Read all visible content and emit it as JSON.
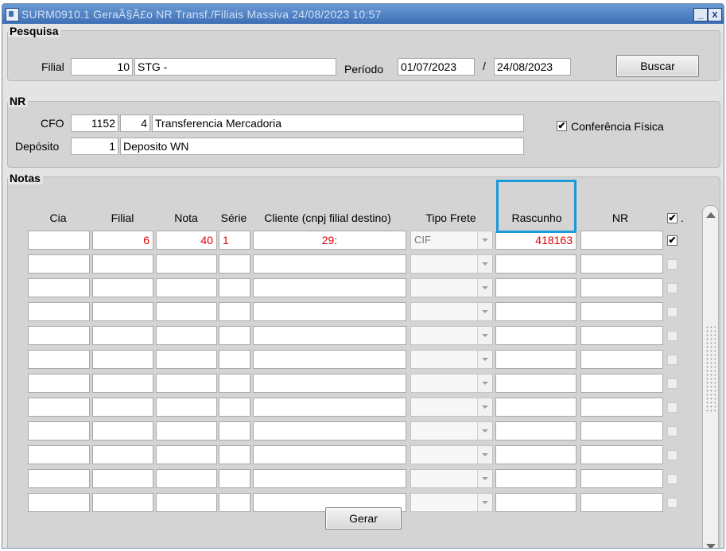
{
  "window": {
    "title": "SURM0910.1   GeraÃ§Ã£o NR Transf./Filiais Massiva   24/08/2023 10:57",
    "minimize_label": "_",
    "close_label": "x"
  },
  "pesquisa": {
    "section_label": "Pesquisa",
    "filial_label": "Filial",
    "filial_code": "10",
    "filial_name": "STG -",
    "periodo_label": "Período",
    "periodo_start": "01/07/2023",
    "periodo_sep": "/",
    "periodo_end": "24/08/2023",
    "buscar_label": "Buscar"
  },
  "nr": {
    "section_label": "NR",
    "cfo_label": "CFO",
    "cfo_code": "1152",
    "cfo_seq": "4",
    "cfo_desc": "Transferencia Mercadoria",
    "conferencia_label": "Conferência Física",
    "conferencia_checked": true,
    "deposito_label": "Depósito",
    "deposito_code": "1",
    "deposito_desc": "Deposito WN"
  },
  "notas": {
    "section_label": "Notas",
    "columns": [
      "Cia",
      "Filial",
      "Nota",
      "Série",
      "Cliente (cnpj filial destino)",
      "Tipo Frete",
      "Rascunho",
      "NR"
    ],
    "select_all_checked": true,
    "select_all_suffix": ".",
    "first_row": {
      "cia": "",
      "filial": "6",
      "nota": "40",
      "serie": "1",
      "cliente": "29:",
      "tipo_frete": "CIF",
      "rascunho": "418163",
      "nr": "",
      "checked": true
    },
    "empty_rows": 11
  },
  "actions": {
    "gerar_label": "Gerar"
  }
}
